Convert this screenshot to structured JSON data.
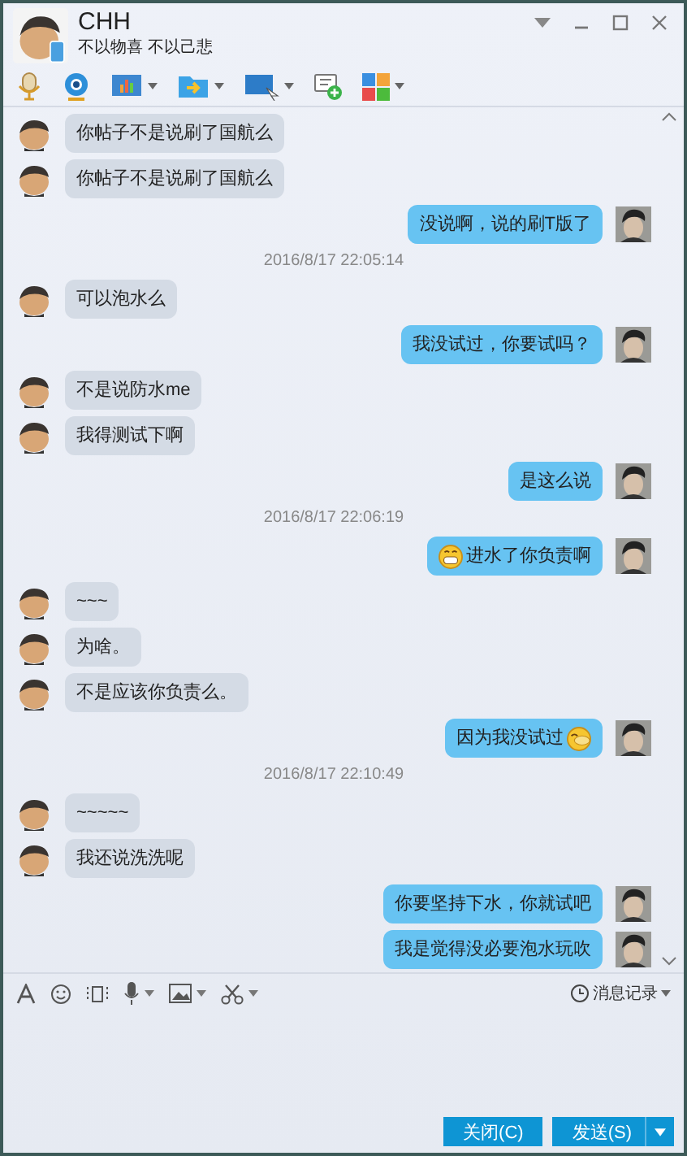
{
  "window": {
    "title": "CHH",
    "status": "不以物喜 不以己悲"
  },
  "messages": [
    {
      "kind": "them",
      "text": "你帖子不是说刷了国航么"
    },
    {
      "kind": "them",
      "text": "你帖子不是说刷了国航么"
    },
    {
      "kind": "me",
      "text": "没说啊，说的刷T版了"
    },
    {
      "kind": "time",
      "text": "2016/8/17 22:05:14"
    },
    {
      "kind": "them",
      "text": "可以泡水么"
    },
    {
      "kind": "me",
      "text": "我没试过，你要试吗？"
    },
    {
      "kind": "them",
      "text": "不是说防水me"
    },
    {
      "kind": "them",
      "text": "我得测试下啊"
    },
    {
      "kind": "me",
      "text": "是这么说"
    },
    {
      "kind": "time",
      "text": "2016/8/17 22:06:19"
    },
    {
      "kind": "me",
      "text": "进水了你负责啊",
      "leading_emoji": true
    },
    {
      "kind": "them",
      "text": "~~~"
    },
    {
      "kind": "them",
      "text": "为啥。"
    },
    {
      "kind": "them",
      "text": "不是应该你负责么。"
    },
    {
      "kind": "me",
      "text": "因为我没试过",
      "trailing_emoji": true
    },
    {
      "kind": "time",
      "text": "2016/8/17 22:10:49"
    },
    {
      "kind": "them",
      "text": "~~~~~"
    },
    {
      "kind": "them",
      "text": "我还说洗洗呢"
    },
    {
      "kind": "me",
      "text": "你要坚持下水，你就试吧"
    },
    {
      "kind": "me",
      "text": "我是觉得没必要泡水玩吹"
    }
  ],
  "history": {
    "label": "消息记录"
  },
  "buttons": [
    {
      "label": "关闭(C)"
    },
    {
      "label": "发送(S)"
    }
  ]
}
